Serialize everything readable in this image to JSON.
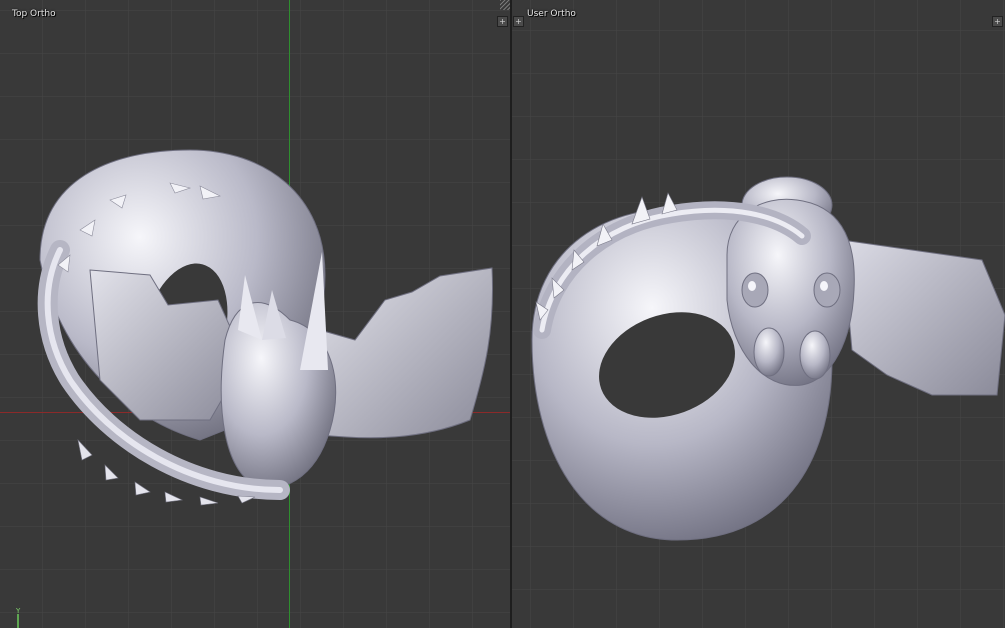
{
  "viewports": {
    "left": {
      "label": "Top Ortho",
      "axis_y_label": "Y"
    },
    "right": {
      "label": "User Ortho"
    }
  },
  "widgets": {
    "expand_glyph": "+",
    "split_icon": "split-corner-icon"
  },
  "colors": {
    "background": "#393939",
    "grid": "#464646",
    "x_axis": "#8c2a2a",
    "y_axis": "#2f8f2f",
    "model_light": "#f2f2f7",
    "model_mid": "#b5b5c4",
    "model_dark": "#6f6f80"
  }
}
